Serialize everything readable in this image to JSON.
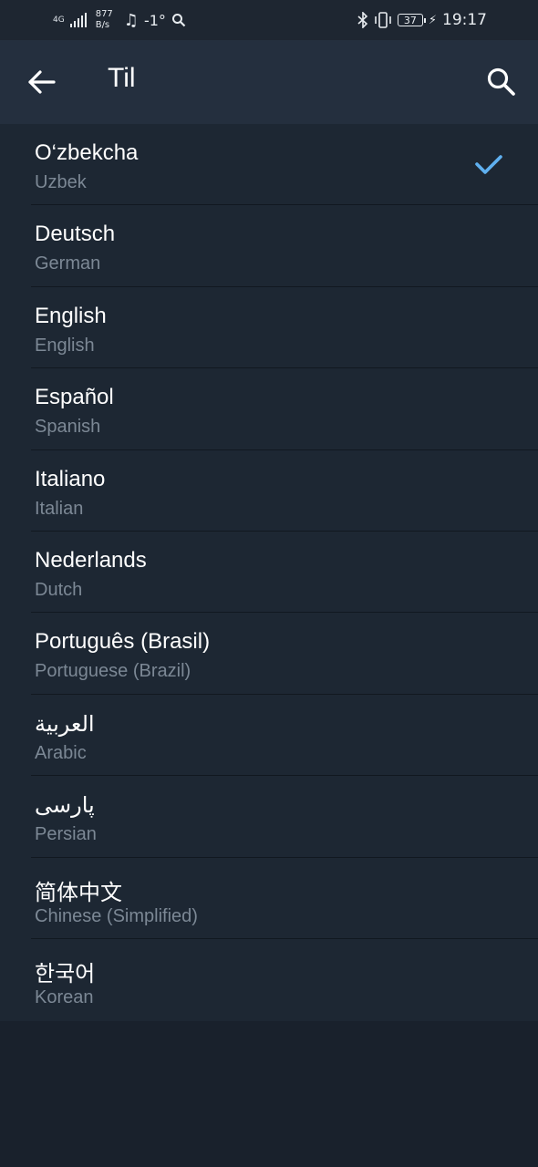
{
  "status_bar": {
    "network_type": "4G",
    "speed_value": "877",
    "speed_unit": "B/s",
    "temperature": "-1°",
    "battery": "37",
    "time": "19:17"
  },
  "toolbar": {
    "title": "Til"
  },
  "languages": [
    {
      "name": "O‘zbekcha",
      "sub": "Uzbek",
      "selected": true
    },
    {
      "name": "Deutsch",
      "sub": "German",
      "selected": false
    },
    {
      "name": "English",
      "sub": "English",
      "selected": false
    },
    {
      "name": "Español",
      "sub": "Spanish",
      "selected": false
    },
    {
      "name": "Italiano",
      "sub": "Italian",
      "selected": false
    },
    {
      "name": "Nederlands",
      "sub": "Dutch",
      "selected": false
    },
    {
      "name": "Português (Brasil)",
      "sub": "Portuguese (Brazil)",
      "selected": false
    },
    {
      "name": "العربية",
      "sub": "Arabic",
      "selected": false
    },
    {
      "name": "پارسی",
      "sub": "Persian",
      "selected": false
    },
    {
      "name": "简体中文",
      "sub": "Chinese (Simplified)",
      "selected": false
    },
    {
      "name": "한국어",
      "sub": "Korean",
      "selected": false
    }
  ],
  "colors": {
    "accent_check": "#5fb0f0",
    "background": "#1d2733",
    "toolbar": "#242f3e"
  }
}
